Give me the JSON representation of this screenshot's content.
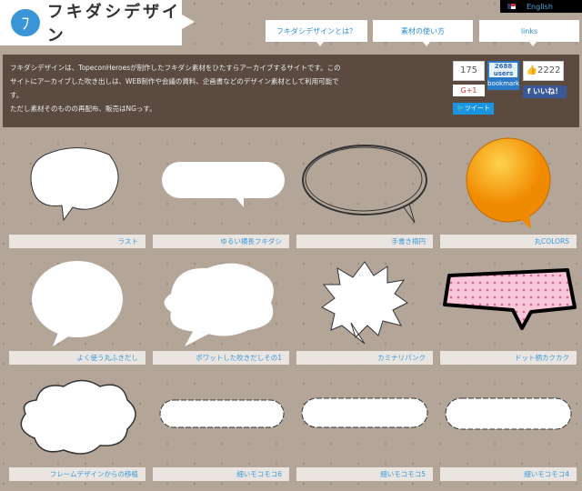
{
  "logo": {
    "mark": "ﾌ",
    "text": "フキダシデザイン"
  },
  "lang": {
    "label": "English"
  },
  "nav": [
    {
      "label": "フキダシデザインとは？"
    },
    {
      "label": "素材の使い方"
    },
    {
      "label": "links"
    }
  ],
  "intro": {
    "lines": [
      "フキダシデザインは、TopeconHeroesが制作したフキダシ素材をひたすらアーカイブするサイトです。このサイトにアーカイブした吹き出しは、WEB制作や会議の資料、企画書などのデザイン素材として利用可能です。",
      "ただし素材そのものの再配布、販売はNGっす。"
    ]
  },
  "social": {
    "gplus_count": "175",
    "gplus_label": "G+1",
    "hatena_count": "2688",
    "hatena_users": "users",
    "hatena_label": "bookmark",
    "fb_count": "2222",
    "fb_label": "いいね！",
    "tweet_label": "ツイート"
  },
  "items": [
    {
      "label": "ラスト"
    },
    {
      "label": "ゆるい横長フキダシ"
    },
    {
      "label": "手書き楕円"
    },
    {
      "label": "丸COLORS"
    },
    {
      "label": "よく使う丸ふきだし"
    },
    {
      "label": "ポワットした吹きだしその1"
    },
    {
      "label": "カミナリパンク"
    },
    {
      "label": "ドット柄カクカク"
    },
    {
      "label": "フレームデザインからの移植"
    },
    {
      "label": "細いモコモコ6"
    },
    {
      "label": "細いモコモコ5"
    },
    {
      "label": "細いモコモコ4"
    }
  ]
}
